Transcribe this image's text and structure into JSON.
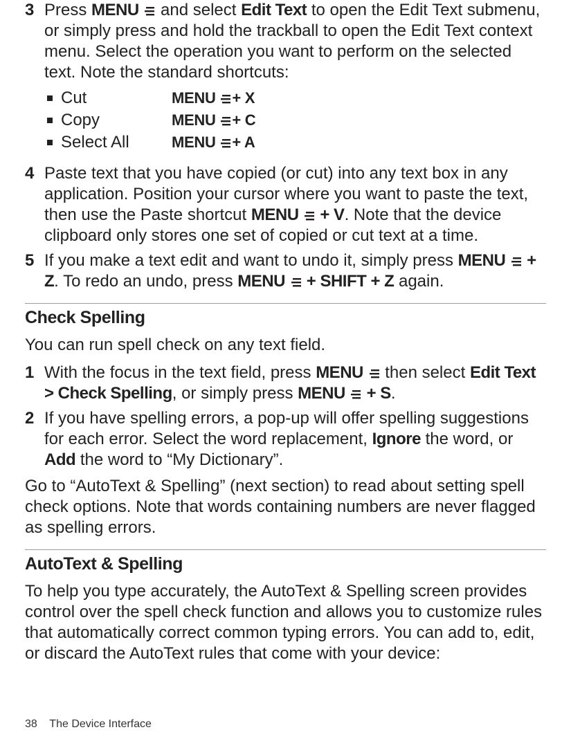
{
  "steps_a": [
    {
      "num": "3",
      "text_parts": [
        {
          "t": "Press "
        },
        {
          "t": "MENU",
          "bold": true,
          "menu": false
        },
        {
          "icon": true
        },
        {
          "t": " and select "
        },
        {
          "t": "Edit Text",
          "bold": true
        },
        {
          "t": " to open the Edit Text submenu, or simply press and hold the trackball to open the Edit Text context menu. Select the operation you want to perform on the selected text. Note the standard shortcuts:"
        }
      ],
      "shortcuts": [
        {
          "label": "Cut",
          "combo_prefix": "MENU",
          "combo_suffix": "+ X"
        },
        {
          "label": "Copy",
          "combo_prefix": "MENU",
          "combo_suffix": "+ C"
        },
        {
          "label": "Select All",
          "combo_prefix": "MENU",
          "combo_suffix": "+ A"
        }
      ]
    },
    {
      "num": "4",
      "text_parts": [
        {
          "t": "Paste text that you have copied (or cut) into any text box in any application. Position your cursor where you want to paste the text, then use the Paste shortcut "
        },
        {
          "t": "MENU",
          "bold": true
        },
        {
          "icon": true
        },
        {
          "t": " + V",
          "bold": true
        },
        {
          "t": ". Note that the device clipboard only stores one set of copied or cut text at a time."
        }
      ]
    },
    {
      "num": "5",
      "text_parts": [
        {
          "t": "If you make a text edit and want to undo it, simply press "
        },
        {
          "t": "MENU",
          "bold": true
        },
        {
          "icon": true
        },
        {
          "t": " + Z",
          "bold": true
        },
        {
          "t": ". To redo an undo, press "
        },
        {
          "t": "MENU",
          "bold": true
        },
        {
          "icon": true
        },
        {
          "t": " + SHIFT",
          "bold": true
        },
        {
          "t": " + Z",
          "bold": true
        },
        {
          "t": " again."
        }
      ]
    }
  ],
  "section_b": {
    "heading": "Check Spelling",
    "intro": "You can run spell check on any text field.",
    "steps": [
      {
        "num": "1",
        "text_parts": [
          {
            "t": "With the focus in the text field, press "
          },
          {
            "t": "MENU",
            "bold": true
          },
          {
            "icon": true
          },
          {
            "t": " then select "
          },
          {
            "t": "Edit Text > Check Spelling",
            "bold": true
          },
          {
            "t": ", or simply press "
          },
          {
            "t": "MENU",
            "bold": true
          },
          {
            "icon": true
          },
          {
            "t": " + S",
            "bold": true
          },
          {
            "t": "."
          }
        ]
      },
      {
        "num": "2",
        "text_parts": [
          {
            "t": "If you have spelling errors, a pop-up will offer spelling suggestions for each error. Select the word replacement, "
          },
          {
            "t": "Ignore",
            "bold": true
          },
          {
            "t": " the word, or "
          },
          {
            "t": "Add",
            "bold": true
          },
          {
            "t": " the word to “My Dictionary”."
          }
        ]
      }
    ],
    "outro": "Go to “AutoText & Spelling” (next section) to read about setting spell check options. Note that words containing numbers are never flagged as spelling errors."
  },
  "section_c": {
    "heading": "AutoText & Spelling",
    "intro": "To help you type accurately, the AutoText & Spelling screen provides control over the spell check function and allows you to customize rules that automatically correct common typing errors. You can add to, edit, or discard the AutoText rules that come with your device:"
  },
  "footer": {
    "page_num": "38",
    "title": "The Device Interface"
  }
}
